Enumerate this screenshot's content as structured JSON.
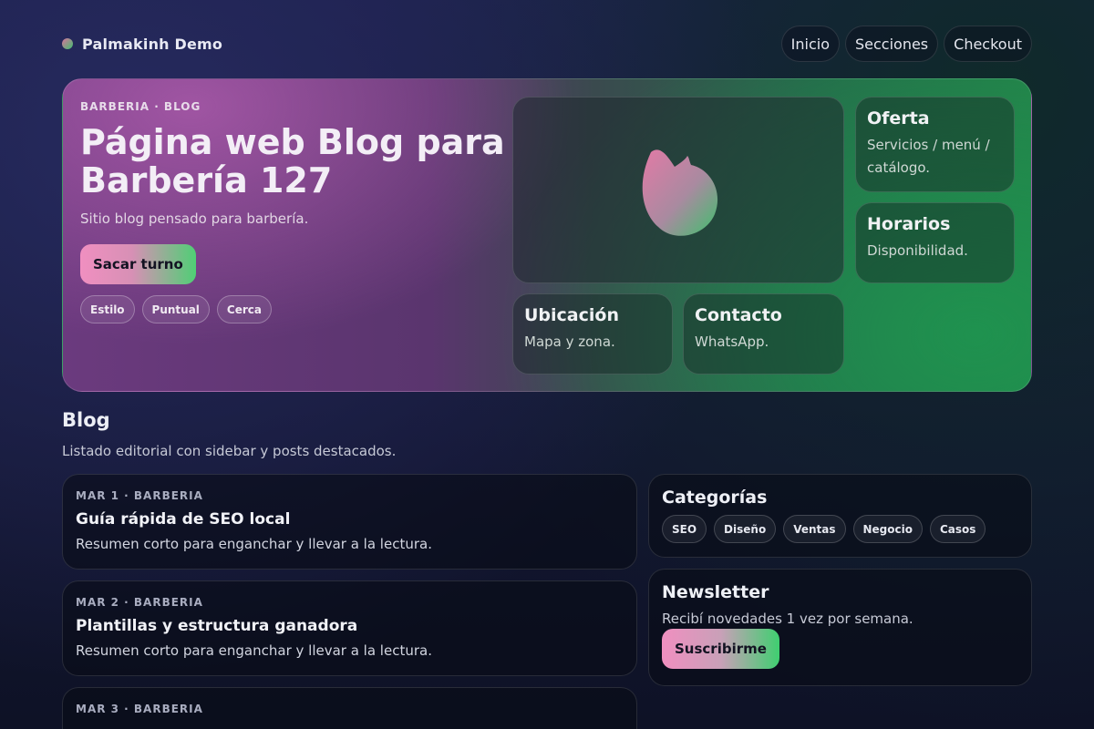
{
  "brand": {
    "name": "Palmakinh Demo"
  },
  "nav": {
    "items": [
      "Inicio",
      "Secciones",
      "Checkout"
    ]
  },
  "hero": {
    "eyebrow": "BARBERIA · BLOG",
    "title": "Página web Blog para Barbería 127",
    "subtitle": "Sitio blog pensado para barbería.",
    "cta_label": "Sacar turno",
    "tags": [
      "Estilo",
      "Puntual",
      "Cerca"
    ],
    "cards": {
      "oferta": {
        "title": "Oferta",
        "text": "Servicios / menú / catálogo."
      },
      "horarios": {
        "title": "Horarios",
        "text": "Disponibilidad."
      },
      "ubicacion": {
        "title": "Ubicación",
        "text": "Mapa y zona."
      },
      "contacto": {
        "title": "Contacto",
        "text": "WhatsApp."
      }
    }
  },
  "blog": {
    "title": "Blog",
    "subtitle": "Listado editorial con sidebar y posts destacados.",
    "posts": [
      {
        "meta": "MAR 1 · BARBERIA",
        "title": "Guía rápida de SEO local",
        "excerpt": "Resumen corto para enganchar y llevar a la lectura."
      },
      {
        "meta": "MAR 2 · BARBERIA",
        "title": "Plantillas y estructura ganadora",
        "excerpt": "Resumen corto para enganchar y llevar a la lectura."
      },
      {
        "meta": "MAR 3 · BARBERIA",
        "title": "",
        "excerpt": ""
      }
    ]
  },
  "sidebar": {
    "categories": {
      "title": "Categorías",
      "items": [
        "SEO",
        "Diseño",
        "Ventas",
        "Negocio",
        "Casos"
      ]
    },
    "newsletter": {
      "title": "Newsletter",
      "text": "Recibí novedades 1 vez por semana.",
      "button_label": "Suscribirme"
    }
  },
  "colors": {
    "accent_pink": "#f08fc0",
    "accent_green": "#3fcf70",
    "background": "#151836"
  }
}
